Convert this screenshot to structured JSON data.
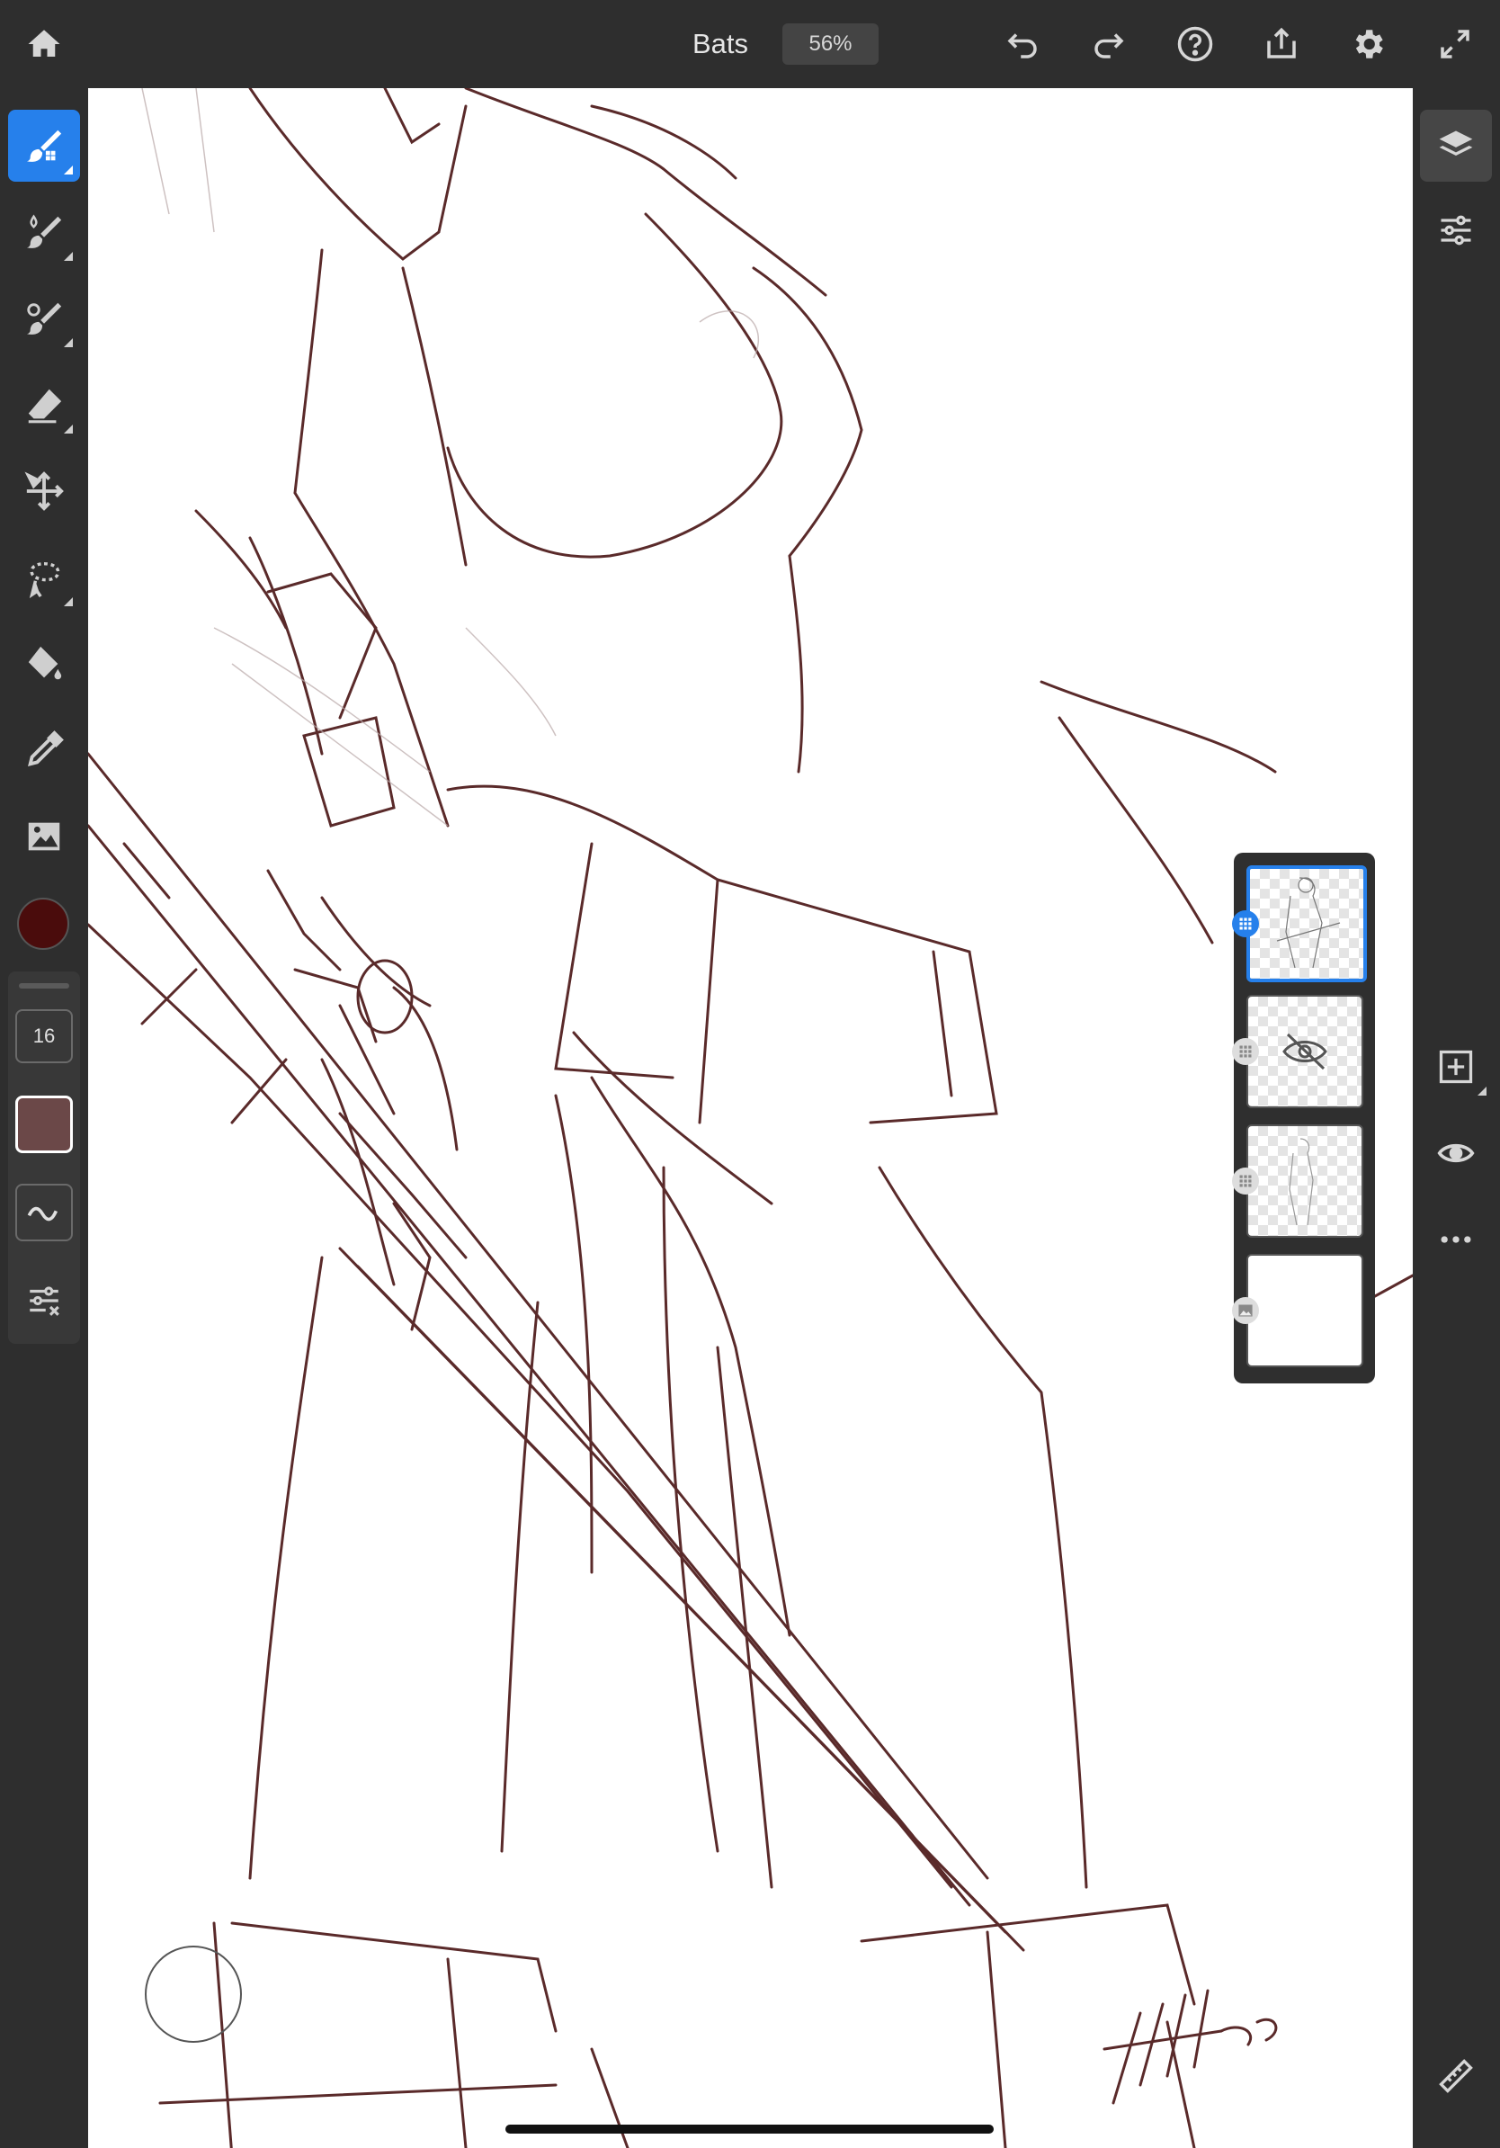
{
  "document": {
    "title": "Bats",
    "zoom": "56%"
  },
  "toolbar": {
    "home": "home-icon",
    "undo": "undo-icon",
    "redo": "redo-icon",
    "help": "help-icon",
    "share": "share-icon",
    "settings": "gear-icon",
    "fullscreen": "fullscreen-icon"
  },
  "tools": [
    {
      "name": "pixel-brush",
      "icon": "pixel-brush-icon",
      "active": true
    },
    {
      "name": "live-brush",
      "icon": "live-brush-icon"
    },
    {
      "name": "mixer-brush",
      "icon": "mixer-brush-icon"
    },
    {
      "name": "eraser",
      "icon": "eraser-icon"
    },
    {
      "name": "transform",
      "icon": "move-icon"
    },
    {
      "name": "selection",
      "icon": "lasso-icon"
    },
    {
      "name": "fill",
      "icon": "fill-bucket-icon"
    },
    {
      "name": "eyedropper",
      "icon": "eyedropper-icon"
    },
    {
      "name": "image",
      "icon": "image-icon"
    }
  ],
  "brush": {
    "color": "#4a0c0c",
    "size": "16",
    "swatch_color": "#6b4848"
  },
  "right_panel": {
    "layers": "layers-icon",
    "properties": "sliders-icon",
    "add_layer": "add-layer-icon",
    "visibility": "eye-icon",
    "more": "more-icon",
    "ruler": "ruler-icon"
  },
  "layers": [
    {
      "kind": "sketch",
      "selected": true,
      "hidden": false
    },
    {
      "kind": "empty",
      "selected": false,
      "hidden": true
    },
    {
      "kind": "sketch",
      "selected": false,
      "hidden": false
    },
    {
      "kind": "image",
      "selected": false,
      "hidden": false
    }
  ],
  "colors": {
    "accent": "#2680eb",
    "ui_bg": "#2e2e2e",
    "stroke": "#5a2a2a"
  }
}
